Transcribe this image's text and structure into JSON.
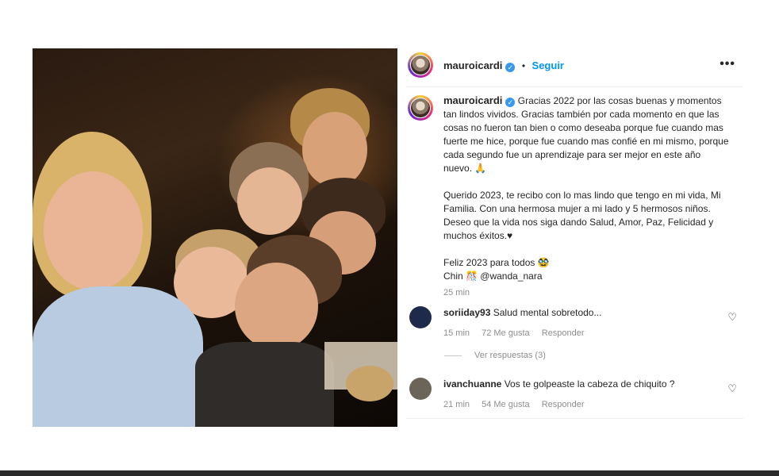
{
  "post": {
    "username": "mauroicardi",
    "separator": "•",
    "follow_label": "Seguir",
    "more_icon": "•••"
  },
  "caption": {
    "username": "mauroicardi",
    "paragraph1": "Gracias 2022 por las cosas buenas y momentos tan lindos vividos. Gracias también por cada momento en que las cosas no fueron tan bien o como deseaba porque fue cuando mas fuerte me hice, porque fue cuando mas confié en mi mismo, porque cada segundo fue un aprendizaje para ser mejor en este año nuevo. 🙏",
    "paragraph2": "Querido 2023, te recibo con lo mas lindo que tengo en mi vida, Mi Familia. Con una hermosa mujer a mi lado y 5 hermosos niños. Deseo que la vida nos siga dando Salud, Amor, Paz, Felicidad y muchos éxitos.♥",
    "line3": "Feliz 2023 para todos 🥸",
    "line4": "Chin 🎊 @wanda_nara",
    "time": "25 min"
  },
  "comments": [
    {
      "username": "soriiday93",
      "text": "Salud mental sobretodo...",
      "time": "15 min",
      "likes": "72 Me gusta",
      "reply_label": "Responder",
      "avatar_color": "#1d2a4a"
    },
    {
      "username": "ivanchuanne",
      "text": "Vos te golpeaste la cabeza de chiquito ?",
      "time": "21 min",
      "likes": "54 Me gusta",
      "reply_label": "Responder",
      "avatar_color": "#6b6459"
    }
  ],
  "view_replies": "Ver respuestas (3)",
  "colors": {
    "accent": "#0095f6",
    "verified": "#3897f0",
    "meta": "#8e8e8e"
  }
}
